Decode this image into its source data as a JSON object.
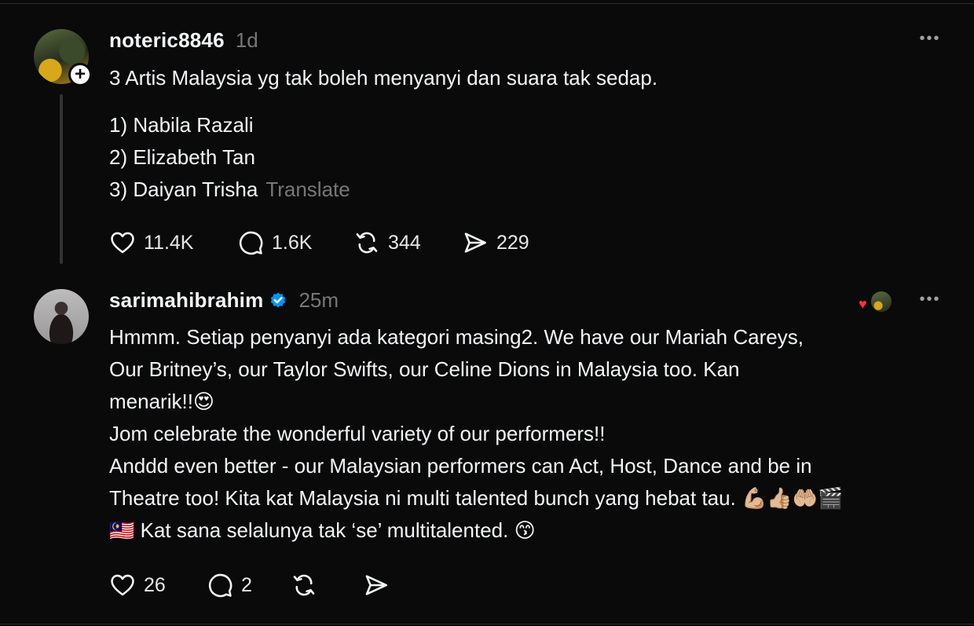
{
  "posts": [
    {
      "username": "noteric8846",
      "time": "1d",
      "text": "3 Artis Malaysia yg tak boleh menyanyi dan suara tak sedap.",
      "list": [
        "1) Nabila Razali",
        "2) Elizabeth Tan",
        "3) Daiyan Trisha"
      ],
      "translate_label": "Translate",
      "follow_symbol": "+",
      "more_symbol": "•••",
      "stats": {
        "likes": "11.4K",
        "replies": "1.6K",
        "reposts": "344",
        "shares": "229"
      }
    },
    {
      "username": "sarimahibrahim",
      "time": "25m",
      "verified": true,
      "more_symbol": "•••",
      "reactor_heart": "♥",
      "body_lines": [
        "Hmmm. Setiap penyanyi ada kategori masing2. We have our Mariah Careys,",
        "Our Britney’s, our Taylor Swifts, our Celine Dions in Malaysia too. Kan",
        "menarik!!😍",
        "Jom celebrate the wonderful variety of our performers!!",
        "Anddd even better - our Malaysian performers can Act, Host, Dance and be in",
        "Theatre too! Kita kat Malaysia ni multi talented bunch yang hebat tau. 💪🏼👍🏼🤲🏼🎬",
        "🇲🇾 Kat sana selalunya tak ‘se’ multitalented. 😙"
      ],
      "stats": {
        "likes": "26",
        "replies": "2"
      }
    }
  ],
  "colors": {
    "background": "#0a0a0a",
    "text": "#f3f5f7",
    "secondary_text": "#777777",
    "verified_blue": "#0095f6",
    "heart_red": "#ff3040"
  },
  "icons": [
    "heart-icon",
    "comment-icon",
    "repost-icon",
    "share-icon",
    "more-icon",
    "verified-badge-icon",
    "follow-plus-icon"
  ]
}
